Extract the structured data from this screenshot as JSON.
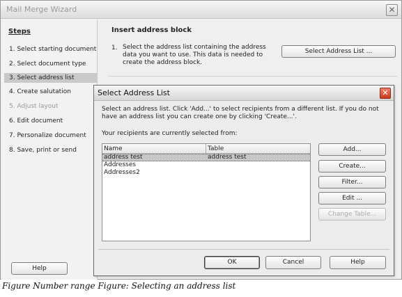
{
  "wizard": {
    "title": "Mail Merge Wizard",
    "close_label": "✕",
    "steps_heading": "Steps",
    "steps": [
      {
        "label": "1. Select starting document",
        "state": "normal"
      },
      {
        "label": "2. Select document type",
        "state": "normal"
      },
      {
        "label": "3. Select address list",
        "state": "active"
      },
      {
        "label": "4. Create salutation",
        "state": "normal"
      },
      {
        "label": "5. Adjust layout",
        "state": "disabled"
      },
      {
        "label": "6. Edit document",
        "state": "normal"
      },
      {
        "label": "7. Personalize document",
        "state": "normal"
      },
      {
        "label": "8. Save, print or send",
        "state": "normal"
      }
    ],
    "help_label": "Help",
    "section_title": "Insert address block",
    "step_number": "1.",
    "step_description": "Select the address list containing the address data you want to use. This data is needed to create the address block.",
    "select_address_list_label": "Select Address List ..."
  },
  "dialog": {
    "title": "Select Address List",
    "close_label": "✕",
    "instructions": "Select an address list. Click 'Add...' to select recipients from a different list. If you do not have an address list you can create one by clicking 'Create...'.",
    "recipients_note": "Your recipients are currently selected from:",
    "columns": [
      "Name",
      "Table"
    ],
    "rows": [
      {
        "name": "address test",
        "table": "address test",
        "selected": true
      },
      {
        "name": "Addresses",
        "table": "",
        "selected": false
      },
      {
        "name": "Addresses2",
        "table": "",
        "selected": false
      }
    ],
    "side_buttons": {
      "add": "Add...",
      "create": "Create...",
      "filter": "Filter...",
      "edit": "Edit ...",
      "change_table": "Change Table..."
    },
    "ok_label": "OK",
    "cancel_label": "Cancel",
    "help_label": "Help"
  },
  "caption": "Figure Number range Figure: Selecting an address list"
}
